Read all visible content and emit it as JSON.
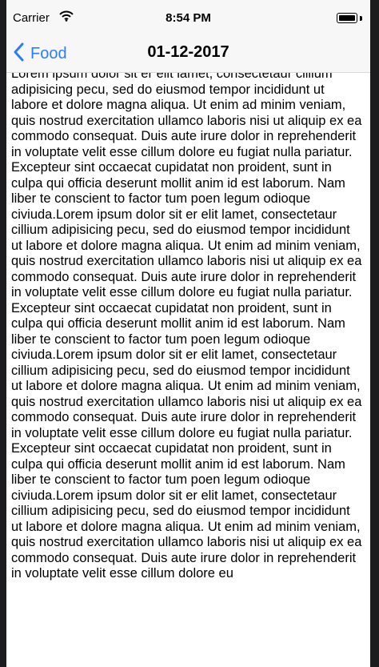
{
  "status_bar": {
    "carrier": "Carrier",
    "time": "8:54 PM"
  },
  "nav": {
    "back_label": "Food",
    "title": "01-12-2017"
  },
  "content": {
    "text": "Lorem ipsum dolor sit er elit lamet, consectetaur cillium adipisicing pecu, sed do eiusmod tempor incididunt ut labore et dolore magna aliqua. Ut enim ad minim veniam, quis nostrud exercitation ullamco laboris nisi ut aliquip ex ea commodo consequat. Duis aute irure dolor in reprehenderit in voluptate velit esse cillum dolore eu fugiat nulla pariatur. Excepteur sint occaecat cupidatat non proident, sunt in culpa qui officia deserunt mollit anim id est laborum. Nam liber te conscient to factor tum poen legum odioque civiuda.Lorem ipsum dolor sit er elit lamet, consectetaur cillium adipisicing pecu, sed do eiusmod tempor incididunt ut labore et dolore magna aliqua. Ut enim ad minim veniam, quis nostrud exercitation ullamco laboris nisi ut aliquip ex ea commodo consequat. Duis aute irure dolor in reprehenderit in voluptate velit esse cillum dolore eu fugiat nulla pariatur. Excepteur sint occaecat cupidatat non proident, sunt in culpa qui officia deserunt mollit anim id est laborum. Nam liber te conscient to factor tum poen legum odioque civiuda.Lorem ipsum dolor sit er elit lamet, consectetaur cillium adipisicing pecu, sed do eiusmod tempor incididunt ut labore et dolore magna aliqua. Ut enim ad minim veniam, quis nostrud exercitation ullamco laboris nisi ut aliquip ex ea commodo consequat. Duis aute irure dolor in reprehenderit in voluptate velit esse cillum dolore eu fugiat nulla pariatur. Excepteur sint occaecat cupidatat non proident, sunt in culpa qui officia deserunt mollit anim id est laborum. Nam liber te conscient to factor tum poen legum odioque civiuda.Lorem ipsum dolor sit er elit lamet, consectetaur cillium adipisicing pecu, sed do eiusmod tempor incididunt ut labore et dolore magna aliqua. Ut enim ad minim veniam, quis nostrud exercitation ullamco laboris nisi ut aliquip ex ea commodo consequat. Duis aute irure dolor in reprehenderit in voluptate velit esse cillum dolore eu"
  },
  "icons": {
    "wifi": "wifi-icon",
    "battery": "battery-icon",
    "back": "chevron-left-icon"
  },
  "colors": {
    "accent": "#2f7cf6",
    "bar_background": "#f7f7f7"
  }
}
